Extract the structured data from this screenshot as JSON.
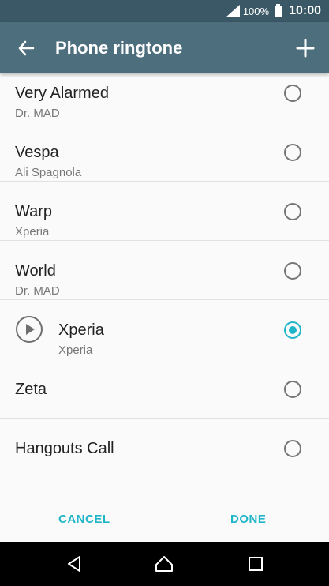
{
  "status_bar": {
    "battery_percent": "100%",
    "time": "10:00"
  },
  "app_bar": {
    "title": "Phone ringtone",
    "back_icon": "arrow-back-icon",
    "add_icon": "add-icon"
  },
  "ringtones": [
    {
      "title": "Very Alarmed",
      "subtitle": "Dr. MAD",
      "selected": false
    },
    {
      "title": "Vespa",
      "subtitle": "Ali Spagnola",
      "selected": false
    },
    {
      "title": "Warp",
      "subtitle": "Xperia",
      "selected": false
    },
    {
      "title": "World",
      "subtitle": "Dr. MAD",
      "selected": false
    },
    {
      "title": "Xperia",
      "subtitle": "Xperia",
      "selected": true,
      "playing_icon": "play-icon"
    },
    {
      "title": "Zeta",
      "subtitle": "",
      "selected": false
    },
    {
      "title": "Hangouts Call",
      "subtitle": "",
      "selected": false
    }
  ],
  "footer": {
    "cancel_label": "CANCEL",
    "done_label": "DONE"
  },
  "colors": {
    "status_bar": "#3a5866",
    "app_bar": "#4d6e7d",
    "accent": "#1fb6c9"
  }
}
